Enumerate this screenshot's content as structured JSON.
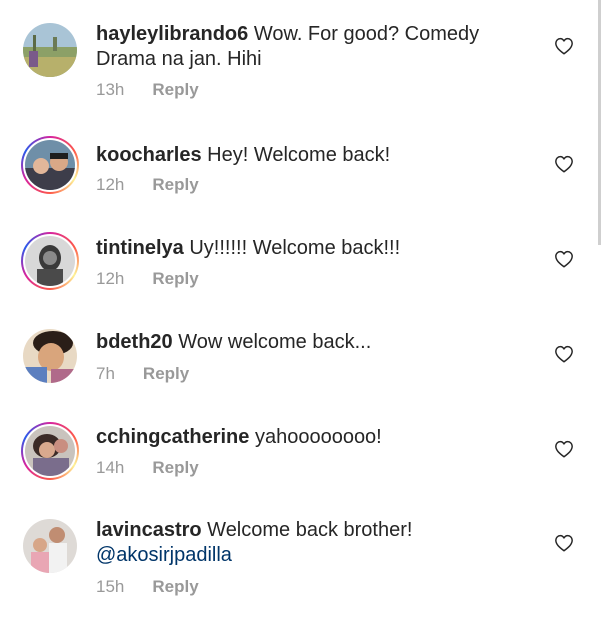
{
  "comments": [
    {
      "username": "hayleylibrando6",
      "text": "Wow. For good? Comedy",
      "text2": "Drama na jan. Hihi",
      "time": "13h",
      "reply": "Reply",
      "avatar": "hayleylibrando6-avatar"
    },
    {
      "username": "koocharles",
      "text": "Hey! Welcome back!",
      "time": "12h",
      "reply": "Reply",
      "avatar": "koocharles-avatar"
    },
    {
      "username": "tintinelya",
      "text": "Uy!!!!!! Welcome back!!!",
      "time": "12h",
      "reply": "Reply",
      "avatar": "tintinelya-avatar"
    },
    {
      "username": "bdeth20",
      "text": "Wow welcome back...",
      "time": "7h",
      "reply": "Reply",
      "avatar": "bdeth20-avatar"
    },
    {
      "username": "cchingcatherine",
      "text": "yahoooooooo!",
      "time": "14h",
      "reply": "Reply",
      "avatar": "cchingcatherine-avatar"
    },
    {
      "username": "lavincastro",
      "text": "Welcome back brother!",
      "mention": "@akosirjpadilla",
      "time": "15h",
      "reply": "Reply",
      "avatar": "lavincastro-avatar"
    }
  ],
  "icons": {
    "like": "heart-outline-icon"
  },
  "colors": {
    "text": "#262626",
    "meta": "#999999",
    "mention": "#003569"
  }
}
